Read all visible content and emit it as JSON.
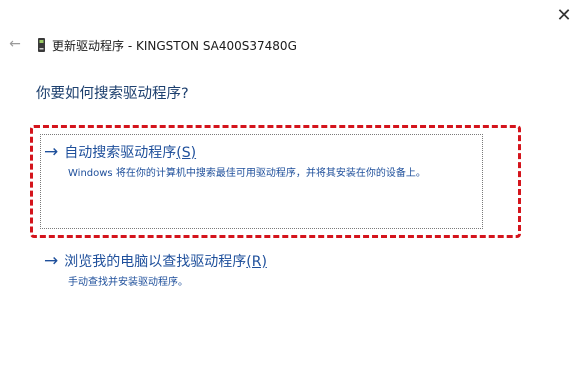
{
  "window": {
    "close_glyph": "✕",
    "back_glyph": "←",
    "title": "更新驱动程序 - KINGSTON SA400S37480G"
  },
  "main": {
    "question": "你要如何搜索驱动程序?",
    "options": [
      {
        "label": "自动搜索驱动程序",
        "accel": "(S)",
        "description": "Windows 将在你的计算机中搜索最佳可用驱动程序，并将其安装在你的设备上。",
        "arrow": "→"
      },
      {
        "label": "浏览我的电脑以查找驱动程序",
        "accel": "(R)",
        "description": "手动查找并安装驱动程序。",
        "arrow": "→"
      }
    ]
  },
  "icons": {
    "close": "close-icon",
    "back": "back-arrow-icon",
    "device": "drive-icon"
  },
  "colors": {
    "link": "#1e4f9b",
    "question": "#1c3f6e",
    "highlight": "#d4141c"
  }
}
